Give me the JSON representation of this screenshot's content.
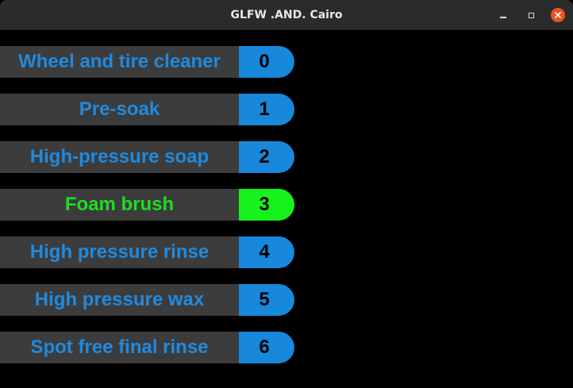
{
  "window": {
    "title": "GLFW .AND. Cairo"
  },
  "colors": {
    "label_text": "#1f8ae0",
    "label_bg": "#3c3c3c",
    "number_bg": "#1788db",
    "active_text": "#19e01e",
    "active_number_bg": "#16f21c",
    "background": "#000000"
  },
  "steps": [
    {
      "label": "Wheel and tire cleaner",
      "number": "0",
      "active": false
    },
    {
      "label": "Pre-soak",
      "number": "1",
      "active": false
    },
    {
      "label": "High-pressure soap",
      "number": "2",
      "active": false
    },
    {
      "label": "Foam brush",
      "number": "3",
      "active": true
    },
    {
      "label": "High pressure rinse",
      "number": "4",
      "active": false
    },
    {
      "label": "High pressure wax",
      "number": "5",
      "active": false
    },
    {
      "label": "Spot free final rinse",
      "number": "6",
      "active": false
    }
  ]
}
